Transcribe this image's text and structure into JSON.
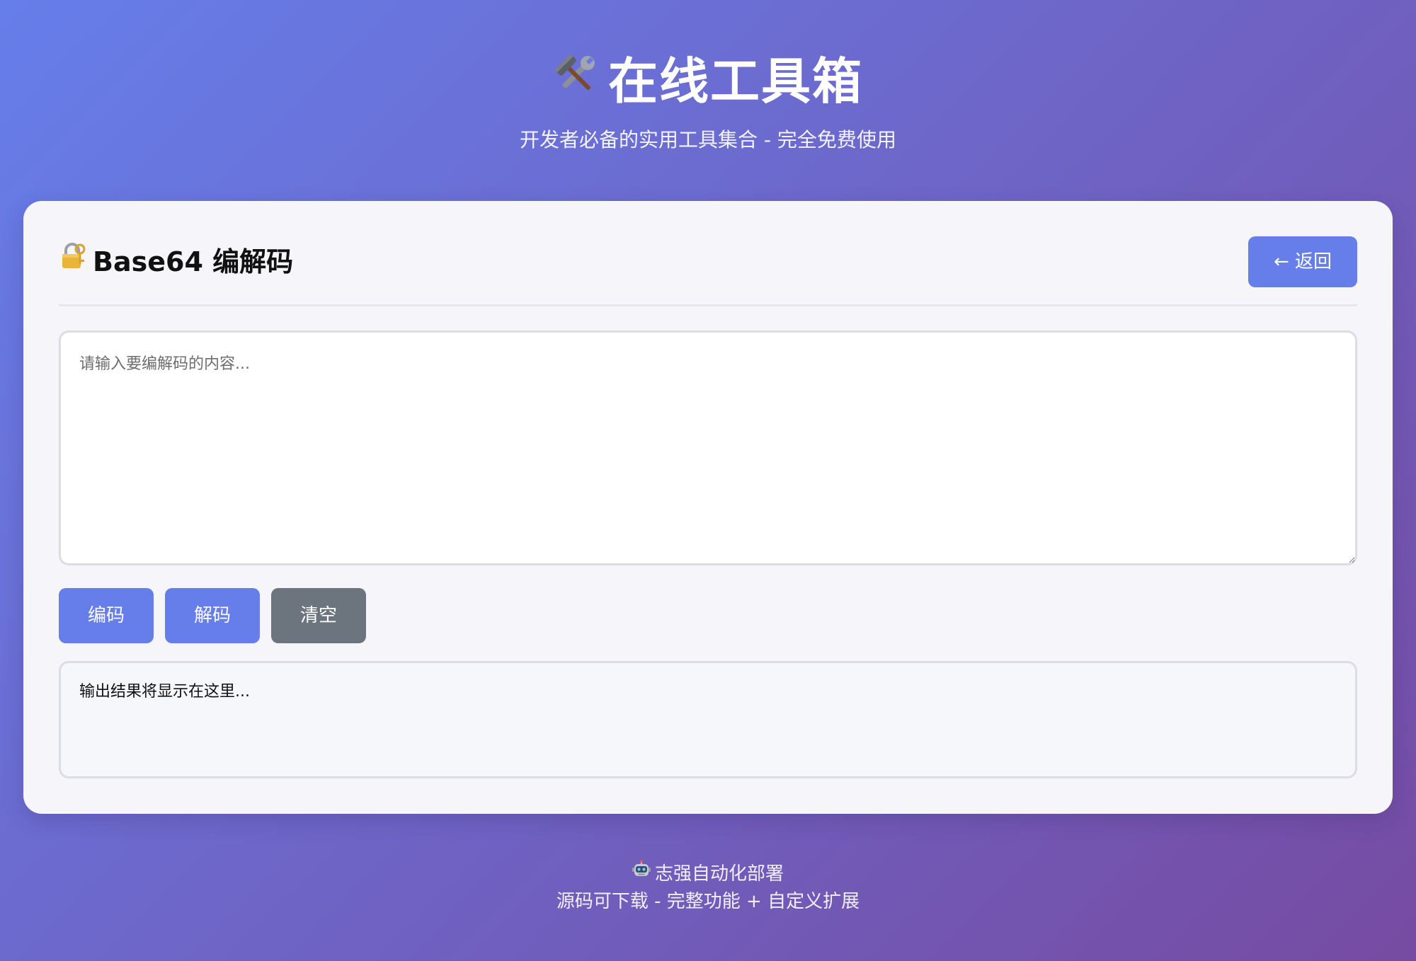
{
  "header": {
    "title": "在线工具箱",
    "title_icon": "hammer-and-wrench-icon",
    "subtitle": "开发者必备的实用工具集合 - 完全免费使用"
  },
  "tool": {
    "title": "Base64 编解码",
    "title_icon": "lock-with-key-icon",
    "back_label": "← 返回",
    "input_placeholder": "请输入要编解码的内容...",
    "input_value": "",
    "buttons": {
      "encode": "编码",
      "decode": "解码",
      "clear": "清空"
    },
    "output_text": "输出结果将显示在这里..."
  },
  "footer": {
    "line1": "志强自动化部署",
    "line1_icon": "robot-icon",
    "line2": "源码可下载 - 完整功能 + 自定义扩展"
  },
  "colors": {
    "gradient_start": "#667eea",
    "gradient_end": "#764ba2",
    "primary_button": "#667eea",
    "secondary_button": "#6c757d",
    "card_background": "#f6f6fa"
  }
}
